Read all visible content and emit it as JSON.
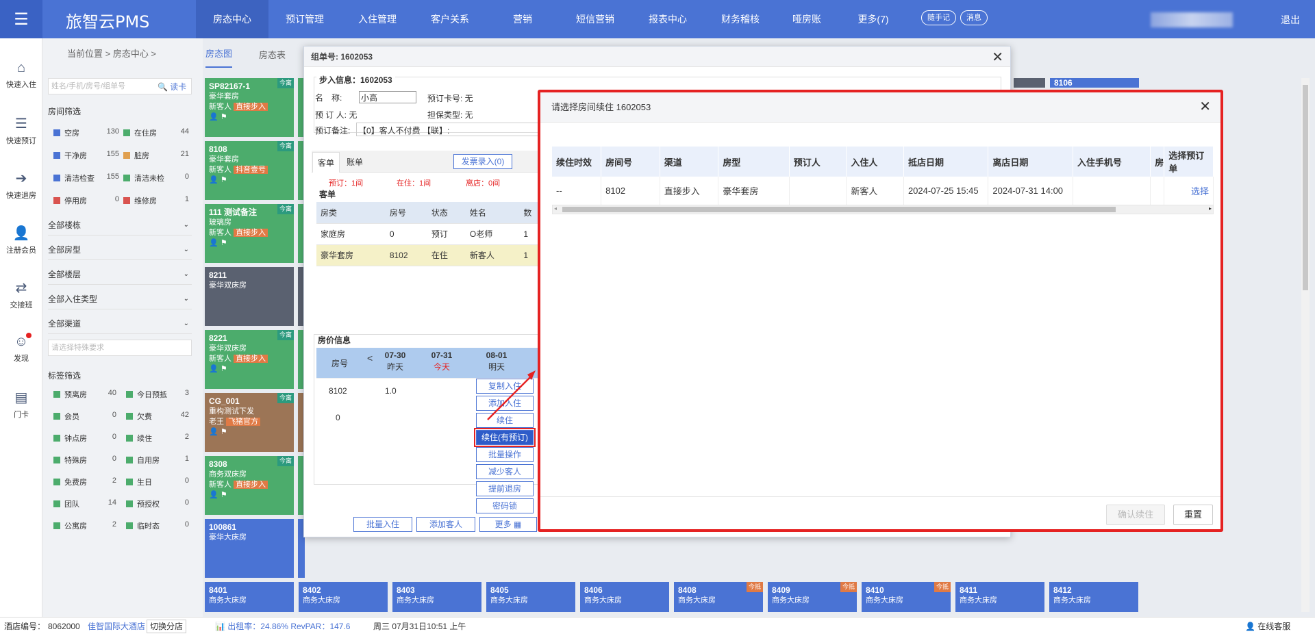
{
  "topbar": {
    "brand": "旅智云PMS",
    "nav": [
      "房态中心",
      "预订管理",
      "入住管理",
      "客户关系",
      "营销",
      "短信营销",
      "报表中心",
      "财务稽核",
      "哑房账",
      "更多(7)"
    ],
    "pills": [
      "随手记",
      "消息"
    ],
    "logout": "退出"
  },
  "rail": [
    "快速入住",
    "快速预订",
    "快速退房",
    "注册会员",
    "交接班",
    "发现",
    "门卡"
  ],
  "breadcrumb": "当前位置 > 房态中心 >",
  "room_tabs": [
    "房态图",
    "房态表"
  ],
  "filter": {
    "search_placeholder": "姓名/手机/房号/组单号",
    "read_card": "读卡",
    "room_filter_title": "房间筛选",
    "stats": [
      [
        "空房",
        "130",
        "#4a73d4"
      ],
      [
        "在住房",
        "44",
        "#4cac6c"
      ],
      [
        "干净房",
        "155",
        "#4a73d4"
      ],
      [
        "脏房",
        "21",
        "#e0a050"
      ],
      [
        "清洁检查",
        "155",
        "#4a73d4"
      ],
      [
        "清洁未检",
        "0",
        "#4cac6c"
      ],
      [
        "停用房",
        "0",
        "#d9534f"
      ],
      [
        "维修房",
        "1",
        "#d9534f"
      ]
    ],
    "selects": [
      "全部楼栋",
      "全部房型",
      "全部楼层",
      "全部入住类型",
      "全部渠道"
    ],
    "special_placeholder": "请选择特殊要求",
    "tag_title": "标签筛选",
    "tags": [
      [
        "预离房",
        "40"
      ],
      [
        "今日预抵",
        "3"
      ],
      [
        "会员",
        "0"
      ],
      [
        "欠费",
        "42"
      ],
      [
        "钟点房",
        "0"
      ],
      [
        "续住",
        "2"
      ],
      [
        "特殊房",
        "0"
      ],
      [
        "自用房",
        "1"
      ],
      [
        "免费房",
        "2"
      ],
      [
        "生日",
        "0"
      ],
      [
        "团队",
        "14"
      ],
      [
        "预授权",
        "0"
      ],
      [
        "公寓房",
        "2"
      ],
      [
        "临时态",
        "0"
      ]
    ]
  },
  "cards": [
    {
      "no": "SP82167-1",
      "type": "豪华套房",
      "guest": "新客人",
      "tag": "直接步入",
      "badge": "今离",
      "color": "green"
    },
    {
      "no": "8108",
      "type": "豪华套房",
      "guest": "新客人",
      "tag": "抖音壹号",
      "badge": "今离",
      "color": "green"
    },
    {
      "no": "111 测试备注",
      "type": "玻璃房",
      "guest": "新客人",
      "tag": "直接步入",
      "badge": "今离",
      "color": "green"
    },
    {
      "no": "8211",
      "type": "豪华双床房",
      "guest": "",
      "tag": "",
      "badge": "",
      "color": "gray"
    },
    {
      "no": "8221",
      "type": "豪华双床房",
      "guest": "新客人",
      "tag": "直接步入",
      "badge": "今离",
      "color": "green"
    },
    {
      "no": "CG_001",
      "type": "重构测试下发",
      "guest": "老王",
      "tag": "飞猪官方",
      "badge": "今离",
      "color": "brown"
    },
    {
      "no": "8308",
      "type": "商务双床房",
      "guest": "新客人",
      "tag": "直接步入",
      "badge": "今离",
      "color": "green"
    },
    {
      "no": "100861",
      "type": "豪华大床房",
      "guest": "",
      "tag": "",
      "badge": "",
      "color": "blue"
    }
  ],
  "bottom_cards": [
    [
      "8401",
      "商务大床房",
      ""
    ],
    [
      "8402",
      "商务大床房",
      ""
    ],
    [
      "8403",
      "商务大床房",
      ""
    ],
    [
      "8405",
      "商务大床房",
      ""
    ],
    [
      "8406",
      "商务大床房",
      ""
    ],
    [
      "8408",
      "商务大床房",
      "今抵"
    ],
    [
      "8409",
      "商务大床房",
      "今抵"
    ],
    [
      "8410",
      "商务大床房",
      "今抵"
    ],
    [
      "8411",
      "商务大床房",
      ""
    ],
    [
      "8412",
      "商务大床房",
      ""
    ]
  ],
  "top_right_card": "8106",
  "order": {
    "title": "组单号: 1602053",
    "info_title": "步入信息：1602053",
    "name_label": "名　称:",
    "name_value": "小高",
    "card_label": "预订卡号: 无",
    "booker": "预 订 人: 无",
    "guarantee": "担保类型: 无",
    "remark_label": "预订备注:",
    "remark": "【0】客人不付费 【联】:",
    "tabs": [
      "客单",
      "账单"
    ],
    "invoice_btn": "发票录入(0)",
    "summary": [
      "预订：1间",
      "在住：1间",
      "离店：0间"
    ],
    "guests_title": "客单",
    "table_head": [
      "房类",
      "房号",
      "状态",
      "姓名",
      "数"
    ],
    "rows": [
      [
        "家庭房",
        "0",
        "预订",
        "O老师",
        "1"
      ],
      [
        "豪华套房",
        "8102",
        "在住",
        "新客人",
        "1"
      ]
    ],
    "price_title": "房价信息",
    "price_head": [
      "房号",
      "07-30",
      "昨天",
      "07-31",
      "今天",
      "08-01",
      "明天"
    ],
    "price_rows": [
      [
        "8102",
        "1.0"
      ],
      [
        "0",
        ""
      ]
    ],
    "menu": [
      "复制入住",
      "添加入住",
      "续住",
      "续住(有预订)",
      "批量操作",
      "减少客人",
      "提前退房",
      "密码锁"
    ],
    "footer": [
      "批量入住",
      "添加客人",
      "更多"
    ]
  },
  "modal": {
    "title": "请选择房间续住 1602053",
    "headers": [
      "续住时效",
      "房间号",
      "渠道",
      "房型",
      "预订人",
      "入住人",
      "抵店日期",
      "离店日期",
      "入住手机号",
      "房",
      "选择预订单"
    ],
    "rows": [
      [
        "--",
        "8102",
        "直接步入",
        "豪华套房",
        "",
        "新客人",
        "2024-07-25 15:45",
        "2024-07-31 14:00",
        "",
        "",
        "选择"
      ]
    ],
    "confirm": "确认续住",
    "reset": "重置"
  },
  "bottombar": {
    "hotel_label": "酒店编号：",
    "hotel_no": "8062000",
    "hotel_name": "佳智国际大酒店",
    "switch": "切换分店",
    "occupancy": "出租率：24.86% RevPAR：147.6",
    "datetime": "周三 07月31日10:51 上午",
    "service": "在线客服"
  }
}
